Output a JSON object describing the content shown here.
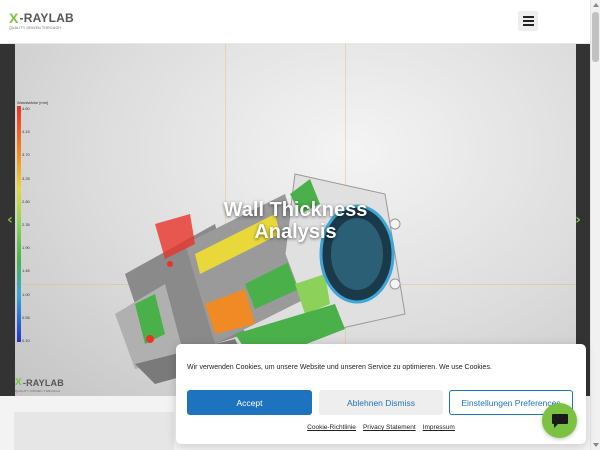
{
  "header": {
    "logo": {
      "x": "X",
      "name": "-RAYLAB",
      "tagline": "QUALITY DRIVEN THROUGH"
    },
    "menu_icon": "hamburger-menu-icon"
  },
  "hero": {
    "slide_title_line1": "Wall Thickness",
    "slide_title_line2": "Analysis",
    "legend": {
      "title": "Wandstärke [mm]",
      "ticks": [
        "4.60",
        "4.15",
        "3.70",
        "3.25",
        "2.80",
        "2.35",
        "1.90",
        "1.45",
        "1.00",
        "0.55",
        "0.10"
      ],
      "colors": [
        "#e8332a",
        "#f08a24",
        "#e8d83a",
        "#8cd25a",
        "#4ab04a",
        "#3fa6d8",
        "#2233cc"
      ]
    },
    "slide_logo": {
      "x": "X",
      "name": "-RAYLAB",
      "tagline": "QUALITY DRIVEN THROUGH"
    },
    "prev_icon": "chevron-left-icon",
    "next_icon": "chevron-right-icon"
  },
  "cookie_banner": {
    "text": "Wir verwenden Cookies, um unsere Website und unseren Service zu optimieren. We use Cookies.",
    "accept_label": "Accept",
    "deny_label": "Ablehnen Dismiss",
    "prefs_label": "Einstellungen Preferences",
    "links": [
      "Cookie-Richtlinie",
      "Privacy Statement",
      "Impressum"
    ]
  },
  "chat": {
    "icon": "chat-bubble-icon"
  },
  "colors": {
    "brand_green": "#7cc242",
    "accent_blue": "#1e73be"
  }
}
